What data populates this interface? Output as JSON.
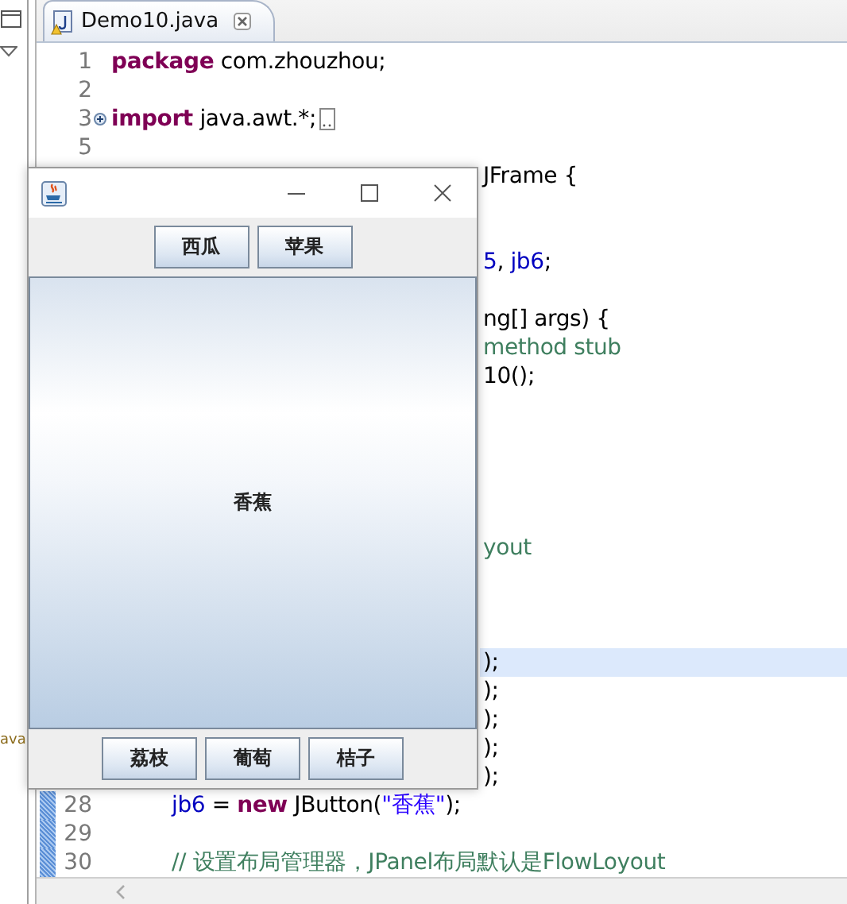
{
  "side_panel": {
    "text": "ava"
  },
  "editor": {
    "tab": {
      "label": "Demo10.java",
      "selected": true
    },
    "lines": [
      {
        "kind": "full",
        "number": "1",
        "changed": false,
        "current": false,
        "tokens": [
          {
            "kind": "keyword",
            "text": "package"
          },
          {
            "kind": "plain",
            "text": " com.zhouzhou;"
          }
        ]
      },
      {
        "kind": "full",
        "number": "2",
        "changed": false,
        "current": false
      },
      {
        "kind": "full",
        "number": "3",
        "changed": false,
        "current": false,
        "folded": true,
        "tokens": [
          {
            "kind": "keyword",
            "text": "import"
          },
          {
            "kind": "plain",
            "text": " java.awt.*;"
          }
        ]
      },
      {
        "kind": "full",
        "number": "5",
        "changed": false,
        "current": false
      },
      {
        "kind": "tail",
        "current": false,
        "tokens": [
          {
            "kind": "plain",
            "text": "JFrame {"
          }
        ]
      },
      {
        "kind": "blank",
        "current": false
      },
      {
        "kind": "blank",
        "current": false
      },
      {
        "kind": "tail",
        "current": false,
        "tokens": [
          {
            "kind": "field",
            "text": "5"
          },
          {
            "kind": "plain",
            "text": ", "
          },
          {
            "kind": "field",
            "text": "jb6"
          },
          {
            "kind": "plain",
            "text": ";"
          }
        ]
      },
      {
        "kind": "blank",
        "current": false
      },
      {
        "kind": "tail",
        "current": false,
        "tokens": [
          {
            "kind": "plain",
            "text": "ng[] args) {"
          }
        ]
      },
      {
        "kind": "tail",
        "current": false,
        "tokens": [
          {
            "kind": "comment",
            "text": "method stub"
          }
        ]
      },
      {
        "kind": "tail",
        "current": false,
        "tokens": [
          {
            "kind": "plain",
            "text": "10();"
          }
        ]
      },
      {
        "kind": "blank",
        "current": false
      },
      {
        "kind": "blank",
        "current": false
      },
      {
        "kind": "blank",
        "current": false
      },
      {
        "kind": "blank",
        "current": false
      },
      {
        "kind": "blank",
        "current": false
      },
      {
        "kind": "tail",
        "current": false,
        "tokens": [
          {
            "kind": "comment",
            "text": "yout"
          }
        ]
      },
      {
        "kind": "blank",
        "current": false
      },
      {
        "kind": "blank",
        "current": false
      },
      {
        "kind": "blank",
        "current": false
      },
      {
        "kind": "tail",
        "current": true,
        "tokens": [
          {
            "kind": "plain",
            "text": ");"
          }
        ]
      },
      {
        "kind": "tail",
        "current": false,
        "tokens": [
          {
            "kind": "plain",
            "text": ");"
          }
        ]
      },
      {
        "kind": "tail",
        "current": false,
        "tokens": [
          {
            "kind": "plain",
            "text": ");"
          }
        ]
      },
      {
        "kind": "tail",
        "current": false,
        "tokens": [
          {
            "kind": "plain",
            "text": ");"
          }
        ]
      },
      {
        "kind": "tail",
        "current": false,
        "tokens": [
          {
            "kind": "plain",
            "text": ");"
          }
        ]
      },
      {
        "kind": "nested",
        "number": "28",
        "changed": true,
        "current": false,
        "tokens": [
          {
            "kind": "field",
            "text": "jb6"
          },
          {
            "kind": "plain",
            "text": " = "
          },
          {
            "kind": "keyword",
            "text": "new"
          },
          {
            "kind": "plain",
            "text": " JButton("
          },
          {
            "kind": "string",
            "text": "\"香蕉\""
          },
          {
            "kind": "plain",
            "text": ");"
          }
        ]
      },
      {
        "kind": "full",
        "number": "29",
        "changed": true,
        "current": false
      },
      {
        "kind": "nested",
        "number": "30",
        "changed": true,
        "current": false,
        "tokens": [
          {
            "kind": "comment",
            "text": "// 设置布局管理器，JPanel布局默认是FlowLoyout"
          }
        ]
      }
    ]
  },
  "app_window": {
    "north": [
      "西瓜",
      "苹果"
    ],
    "center": "香蕉",
    "south": [
      "荔枝",
      "葡萄",
      "桔子"
    ]
  }
}
